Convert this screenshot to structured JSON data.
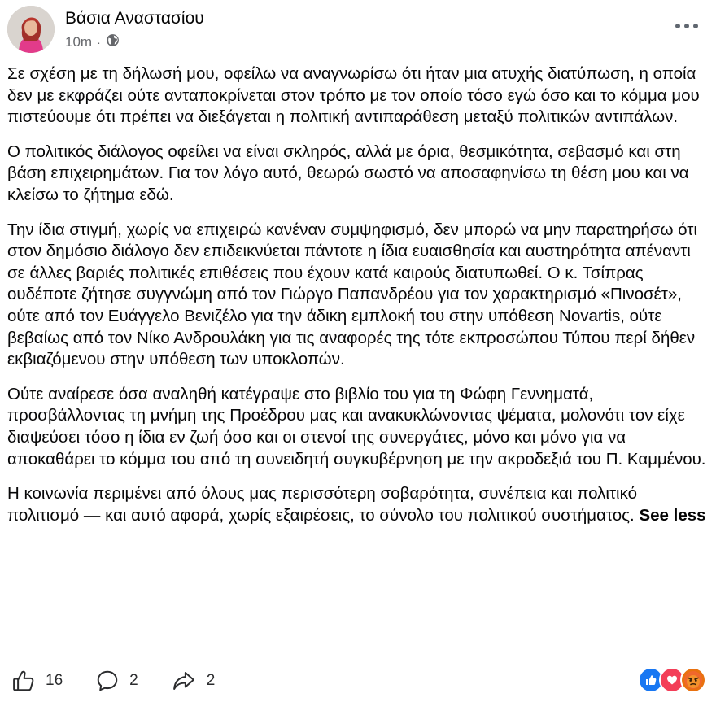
{
  "post": {
    "author": "Βάσια Αναστασίου",
    "time": "10m",
    "audience_icon": "globe-icon",
    "paragraphs": [
      "Σε σχέση με τη δήλωσή μου, οφείλω να αναγνωρίσω ότι ήταν μια ατυχής διατύπωση, η οποία δεν με εκφράζει ούτε ανταποκρίνεται στον τρόπο με τον οποίο τόσο εγώ όσο και το κόμμα μου πιστεύουμε ότι πρέπει να διεξάγεται η πολιτική αντιπαράθεση μεταξύ πολιτικών αντιπάλων.",
      "Ο πολιτικός διάλογος οφείλει να είναι σκληρός, αλλά με όρια, θεσμικότητα, σεβασμό και στη βάση επιχειρημάτων. Για τον λόγο αυτό, θεωρώ σωστό να αποσαφηνίσω τη θέση μου και να κλείσω το ζήτημα εδώ.",
      "Την ίδια στιγμή, χωρίς να επιχειρώ κανέναν συμψηφισμό, δεν μπορώ να μην παρατηρήσω ότι στον δημόσιο διάλογο δεν επιδεικνύεται πάντοτε η ίδια ευαισθησία και αυστηρότητα απέναντι σε άλλες βαριές πολιτικές επιθέσεις που έχουν κατά καιρούς διατυπωθεί. Ο κ. Τσίπρας ουδέποτε ζήτησε συγγνώμη από τον Γιώργο Παπανδρέου για τον χαρακτηρισμό «Πινοσέτ», ούτε από τον Ευάγγελο Βενιζέλο για την άδικη εμπλοκή του στην υπόθεση Novartis, ούτε βεβαίως από τον Νίκο Ανδρουλάκη για τις αναφορές της τότε εκπροσώπου Τύπου περί δήθεν εκβιαζόμενου στην υπόθεση των υποκλοπών.",
      "Ούτε αναίρεσε όσα αναληθή κατέγραψε στο βιβλίο του για τη Φώφη Γεννηματά, προσβάλλοντας τη μνήμη της Προέδρου μας και ανακυκλώνοντας ψέματα, μολονότι τον είχε διαψεύσει τόσο η ίδια εν ζωή όσο και οι στενοί της συνεργάτες, μόνο και μόνο για να αποκαθάρει το κόμμα του από τη συνειδητή συγκυβέρνηση με την ακροδεξιά του Π. Καμμένου.",
      "Η κοινωνία περιμένει από όλους μας περισσότερη σοβαρότητα, συνέπεια και πολιτικό πολιτισμό — και αυτό αφορά, χωρίς εξαιρέσεις, το σύνολο του πολιτικού συστήματος."
    ],
    "see_less": "See less"
  },
  "actions": {
    "likes": "16",
    "comments": "2",
    "shares": "2"
  },
  "reactions": [
    "like",
    "love",
    "angry"
  ],
  "colors": {
    "like_blue": "#1877f2",
    "love_red": "#f33e58",
    "angry_orange": "#e9710f"
  }
}
